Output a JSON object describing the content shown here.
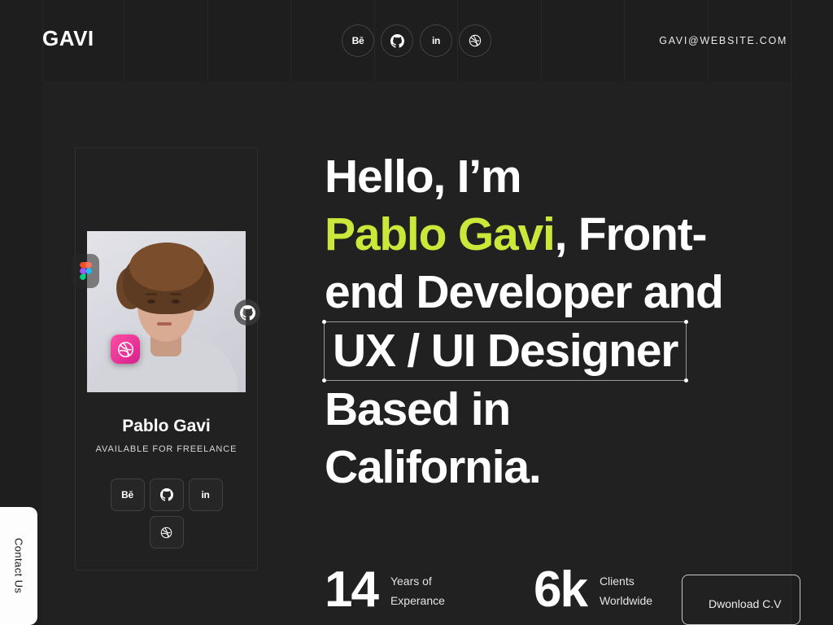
{
  "header": {
    "logo": "GAVI",
    "email": "GAVI@WEBSITE.COM",
    "socials": [
      {
        "name": "behance",
        "label": "Bē"
      },
      {
        "name": "github",
        "label": ""
      },
      {
        "name": "linkedin",
        "label": "in"
      },
      {
        "name": "dribbble",
        "label": ""
      }
    ]
  },
  "profile": {
    "name": "Pablo Gavi",
    "status": "AVAILABLE FOR FREELANCE",
    "socials": [
      {
        "name": "behance",
        "label": "Bē"
      },
      {
        "name": "github",
        "label": ""
      },
      {
        "name": "linkedin",
        "label": "in"
      },
      {
        "name": "dribbble",
        "label": ""
      }
    ],
    "badges": [
      {
        "name": "figma",
        "label": ""
      },
      {
        "name": "github",
        "label": ""
      },
      {
        "name": "dribbble",
        "label": ""
      }
    ]
  },
  "hero": {
    "line1": "Hello, I’m",
    "accent": "Pablo Gavi",
    "after_accent": ", Front-",
    "line3": "end Developer and",
    "selected": "UX / UI Designer",
    "line5": "Based in",
    "line6": "California."
  },
  "stats": [
    {
      "number": "14",
      "label": "Years of Experance"
    },
    {
      "number": "6k",
      "label": "Clients Worldwide"
    }
  ],
  "cta": {
    "cv_button": "Dwonload C.V"
  },
  "contact": {
    "tab_label": "Contact Us"
  },
  "colors": {
    "background": "#1e1e1e",
    "panel": "#212121",
    "accent_green": "#c9e83a",
    "text": "#ffffff",
    "dribbble_pink": "#e3228f"
  }
}
